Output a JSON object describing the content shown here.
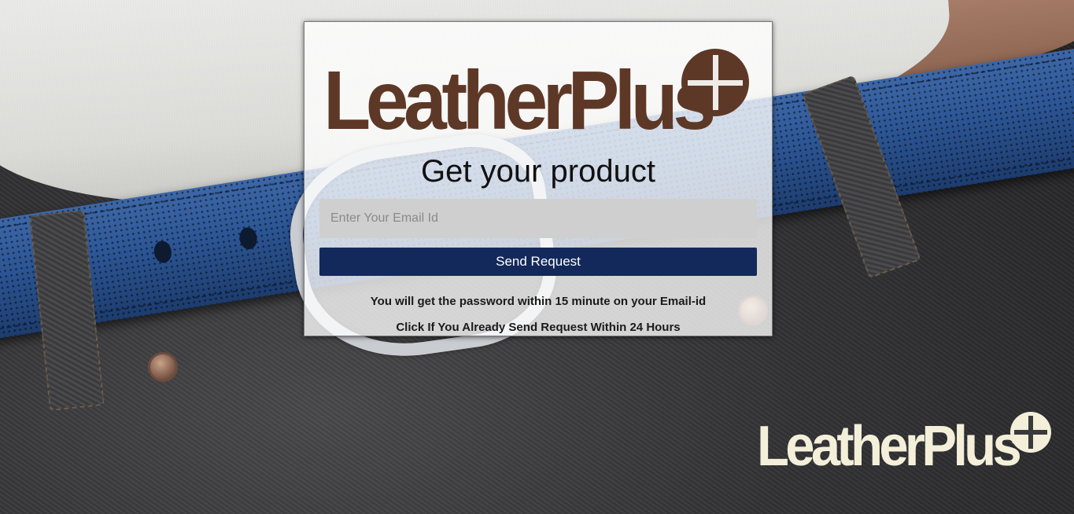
{
  "brand": {
    "logo_text": "LeatherPlus",
    "logo_color": "#5e3827",
    "corner_logo_color": "#f3efd9"
  },
  "form": {
    "title": "Get your product",
    "email_placeholder": "Enter Your Email Id",
    "email_value": "",
    "submit_label": "Send Request",
    "submit_color": "#13295b",
    "info_text": "You will get the password within 15 minute on your Email-id",
    "already_sent_link": "Click If You Already Send Request Within 24 Hours"
  }
}
